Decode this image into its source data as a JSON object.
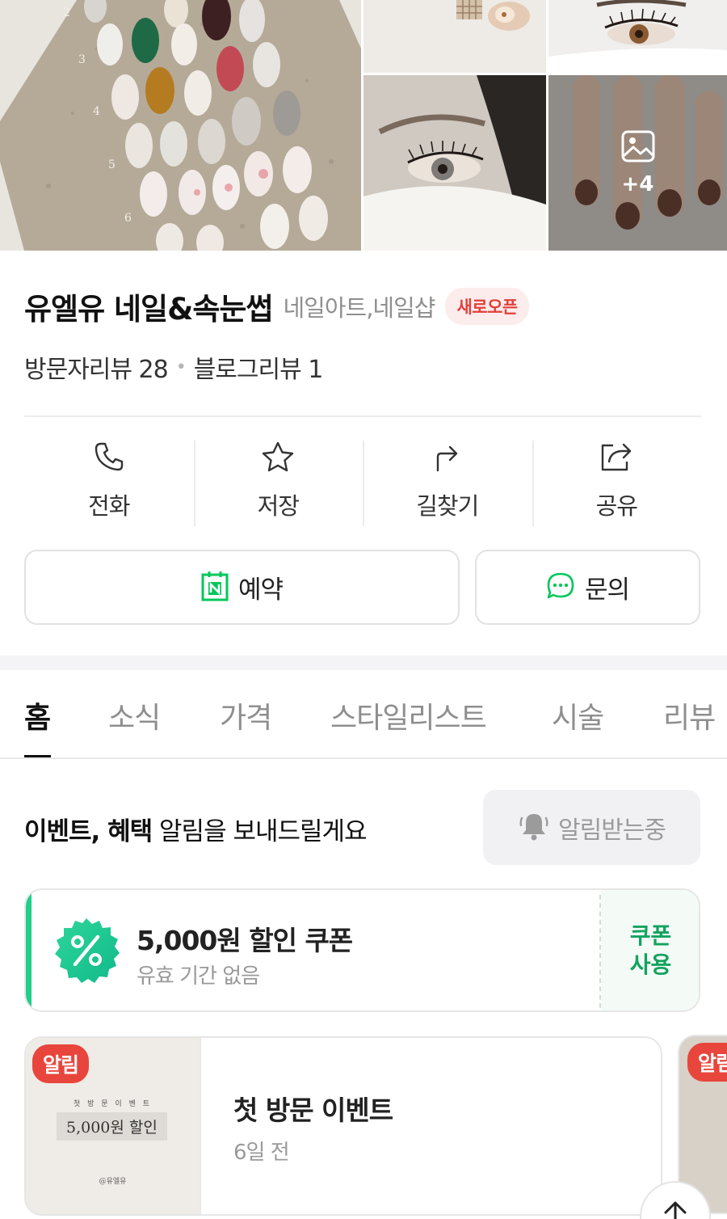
{
  "gallery": {
    "more_count": "+4"
  },
  "place": {
    "name": "유엘유 네일&속눈썹",
    "category": "네일아트,네일샵",
    "badge": "새로오픈",
    "visitor_reviews": "방문자리뷰 28",
    "blog_reviews": "블로그리뷰 1"
  },
  "actions": {
    "call": "전화",
    "save": "저장",
    "directions": "길찾기",
    "share": "공유"
  },
  "buttons": {
    "reserve": "예약",
    "inquiry": "문의"
  },
  "tabs": [
    "홈",
    "소식",
    "가격",
    "스타일리스트",
    "시술",
    "리뷰"
  ],
  "notice": {
    "bold": "이벤트, 혜택",
    "rest": " 알림을 보내드릴게요",
    "button": "알림받는중"
  },
  "coupon": {
    "title": "5,000원 할인 쿠폰",
    "subtitle": "유효 기간 없음",
    "use_button": "쿠폰 사용"
  },
  "event": {
    "badge": "알림",
    "thumb_top": "첫 방 문 이 벤 트",
    "thumb_main": "5,000원 할인",
    "thumb_foot": "@유엘유",
    "title": "첫 방문 이벤트",
    "time": "6일 전"
  },
  "event_next": {
    "badge": "알림"
  },
  "colors": {
    "brand_green": "#1fcf8a",
    "naver_green": "#03c75a",
    "alert_red": "#e8453c"
  }
}
